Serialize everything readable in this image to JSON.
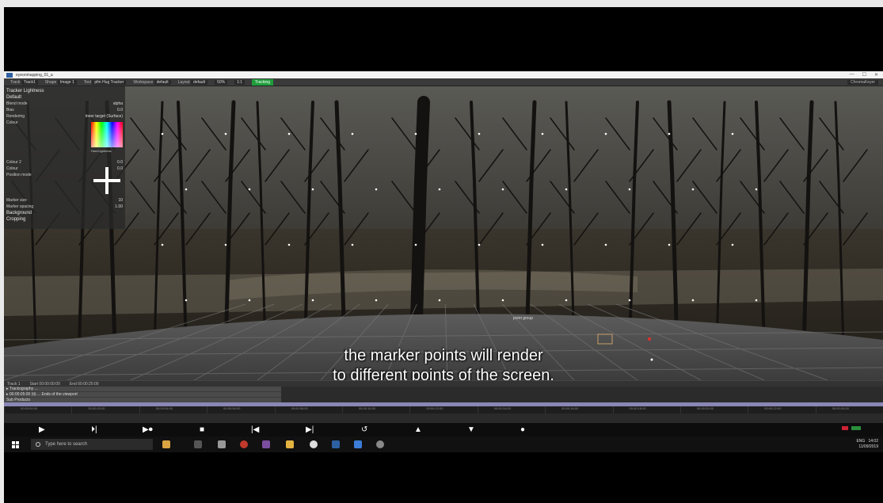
{
  "window": {
    "title": "eyeonmapping_01_a",
    "controls": [
      "—",
      "☐",
      "✕"
    ]
  },
  "toolbar": {
    "items": [
      {
        "label": "Track",
        "value": "Track1"
      },
      {
        "label": "Shape",
        "value": "Image 1"
      },
      {
        "label": "Tool",
        "value": "pfm Hug Tracker"
      },
      {
        "label": "Workspace",
        "value": "default"
      },
      {
        "label": "Layout",
        "value": "default"
      }
    ],
    "zoom": "50%",
    "ratio": "1:1",
    "status_button": "Tracking",
    "right_field": "ChromaKeyer"
  },
  "side_panel": {
    "title": "Tracker Lightness",
    "section": "Default",
    "rows": [
      {
        "label": "Blend mode",
        "value": "alpha"
      },
      {
        "label": "Bias",
        "value": "0.0"
      },
      {
        "label": "Rendering",
        "value": "Inner target (Surface)"
      },
      {
        "label": "Colour",
        "value": ""
      },
      {
        "label": "Colour 2",
        "value": "0.0"
      },
      {
        "label": "Colour",
        "value": "0.0"
      },
      {
        "label": "Position mode",
        "value": ""
      },
      {
        "label": "Marker size",
        "value": "10"
      },
      {
        "label": "Marker spacing",
        "value": "1.00"
      }
    ],
    "color_label": "Hue/Lightness",
    "sections": [
      "Background",
      "Cropping"
    ]
  },
  "viewport": {
    "center_label": "point group"
  },
  "subtitles": {
    "line1": "the marker points will render",
    "line2": "to different points of the screen."
  },
  "outliner": {
    "header": [
      "Track 1",
      "Start 00:00:00:00",
      "End 00:00:25:00"
    ],
    "rows": [
      "▸ Trackography ...",
      "▸ 00:00:05:00 (ti) ... Ends of the viewport",
      "Sub Products"
    ]
  },
  "ruler": {
    "ticks": [
      "00:00:00:00",
      "00:00:02:00",
      "00:00:04:00",
      "00:00:06:00",
      "00:00:08:00",
      "00:00:10:00",
      "00:00:12:00",
      "00:00:14:00",
      "00:00:16:00",
      "00:00:18:00",
      "00:00:20:00",
      "00:00:22:00",
      "00:00:24:00"
    ]
  },
  "transport": {
    "buttons": [
      {
        "name": "play-button",
        "glyph": "▶"
      },
      {
        "name": "step-forward-button",
        "glyph": "⏵|"
      },
      {
        "name": "play-loop-button",
        "glyph": "▶⏺"
      },
      {
        "name": "stop-button",
        "glyph": "■"
      },
      {
        "name": "go-start-button",
        "glyph": "|◀"
      },
      {
        "name": "go-end-button",
        "glyph": "▶|"
      },
      {
        "name": "loop-button",
        "glyph": "↺"
      },
      {
        "name": "keyframe-up-button",
        "glyph": "▲"
      },
      {
        "name": "keyframe-down-button",
        "glyph": "▼"
      },
      {
        "name": "record-button",
        "glyph": "●"
      }
    ]
  },
  "taskbar": {
    "search_placeholder": "Type here to search",
    "time": "14:02",
    "date": "11/09/2019",
    "lang": "ENG"
  },
  "colors": {
    "accent_green": "#1f9d3c",
    "timeline_highlight": "#8a86b5",
    "marker_red": "#e0302a"
  }
}
